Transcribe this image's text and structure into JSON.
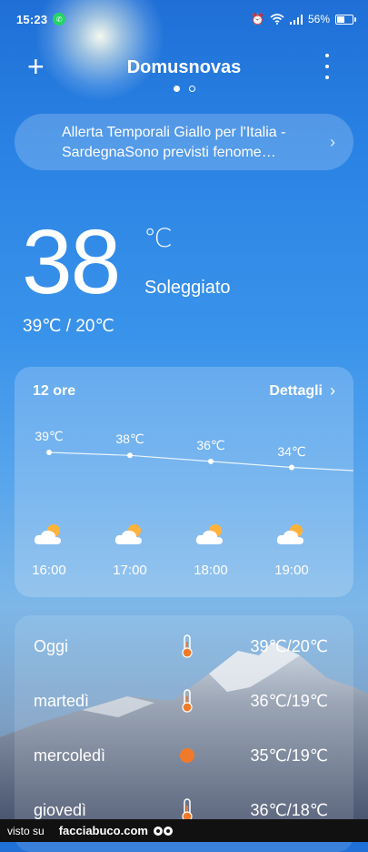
{
  "status_bar": {
    "time": "15:23",
    "battery": "56%",
    "battery_level": 0.56
  },
  "header": {
    "city": "Domusnovas",
    "page_count": 2,
    "active_page": 1
  },
  "alert": {
    "text": "Allerta Temporali Giallo per l'Italia - SardegnaSono previsti fenome…"
  },
  "current": {
    "temperature": "38",
    "unit": "℃",
    "condition": "Soleggiato",
    "high_low": "39℃ / 20℃"
  },
  "hourly": {
    "title": "12 ore",
    "details_label": "Dettagli",
    "items": [
      {
        "time": "16:00",
        "temp": "39℃",
        "value": 39,
        "icon": "partly-cloudy-icon"
      },
      {
        "time": "17:00",
        "temp": "38℃",
        "value": 38,
        "icon": "partly-cloudy-icon"
      },
      {
        "time": "18:00",
        "temp": "36℃",
        "value": 36,
        "icon": "partly-cloudy-icon"
      },
      {
        "time": "19:00",
        "temp": "34℃",
        "value": 34,
        "icon": "partly-cloudy-icon"
      }
    ]
  },
  "daily": [
    {
      "day": "Oggi",
      "range": "39℃/20℃",
      "icon": "thermometer-icon"
    },
    {
      "day": "martedì",
      "range": "36℃/19℃",
      "icon": "thermometer-icon"
    },
    {
      "day": "mercoledì",
      "range": "35℃/19℃",
      "icon": "sun-icon"
    },
    {
      "day": "giovedì",
      "range": "36℃/18℃",
      "icon": "thermometer-icon"
    }
  ],
  "watermark": {
    "left": "visto su",
    "site": "facciabuco.com"
  },
  "colors": {
    "accent_orange": "#f07a2a",
    "sun_yellow": "#ffb23c"
  }
}
